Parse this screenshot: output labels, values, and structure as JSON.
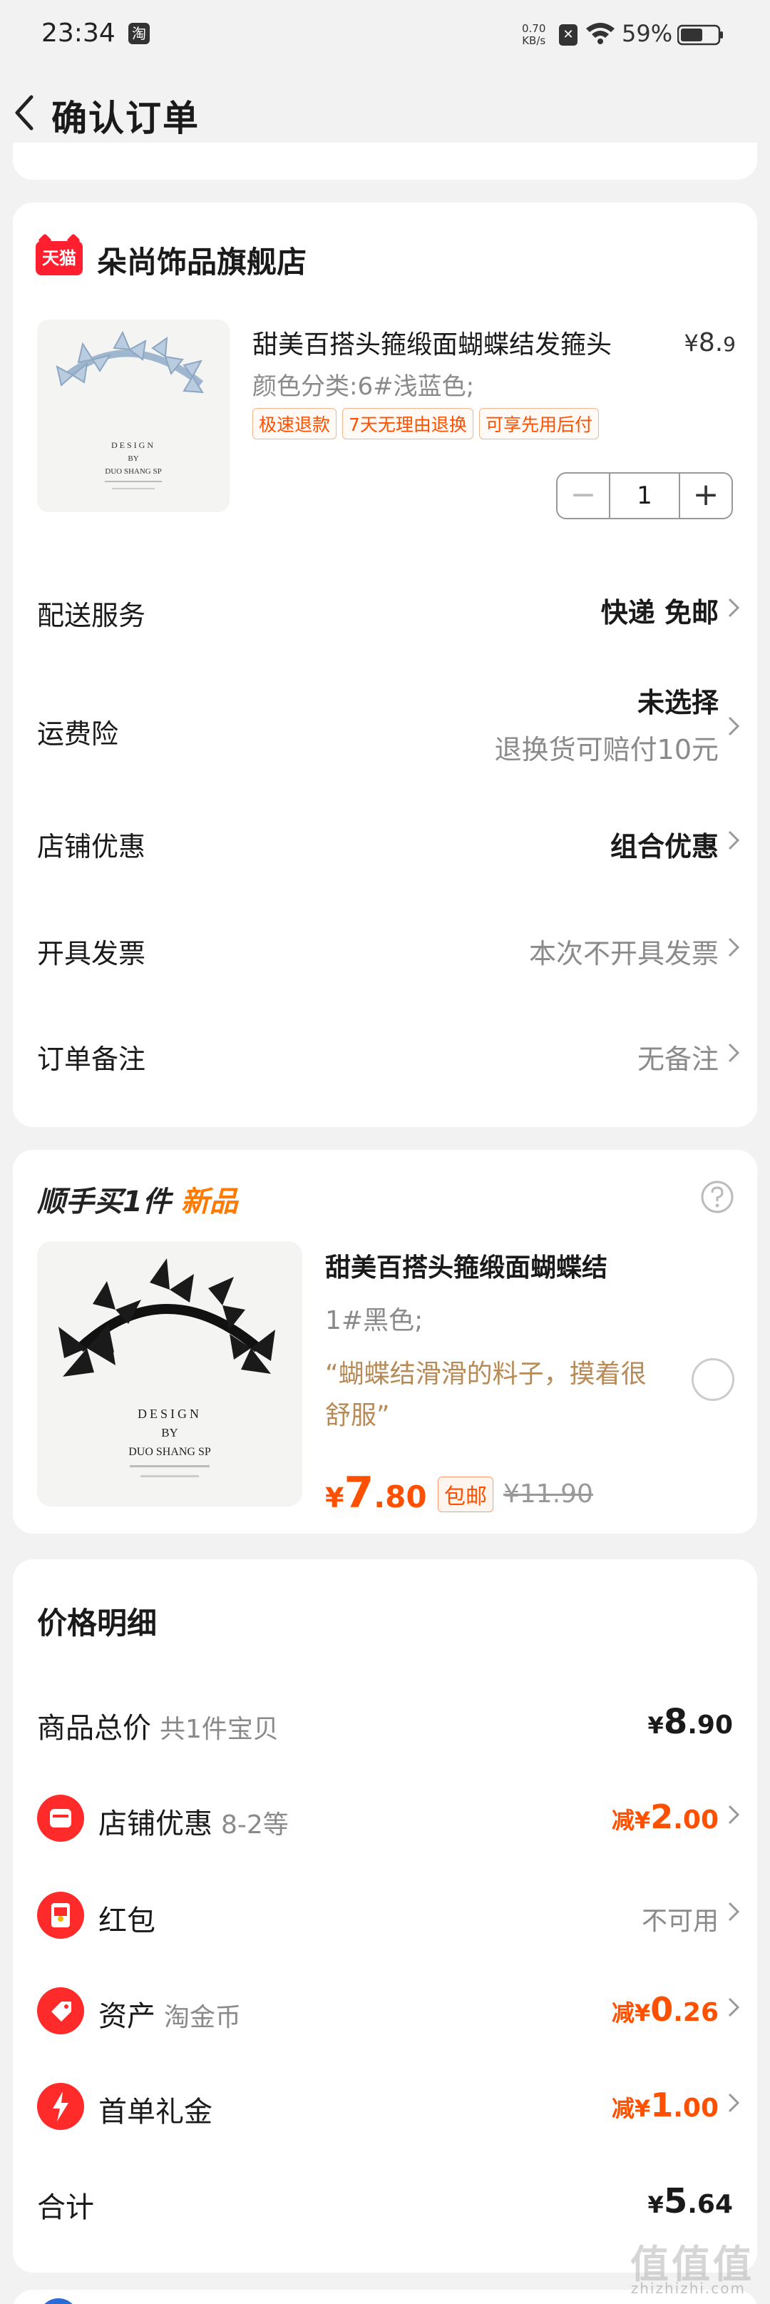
{
  "status": {
    "time": "23:34",
    "app_badge": "淘",
    "speed_value": "0.70",
    "speed_unit": "KB/s",
    "battery": "59%"
  },
  "nav": {
    "title": "确认订单"
  },
  "store": {
    "logo_text": "天猫",
    "name": "朵尚饰品旗舰店",
    "product": {
      "title": "甜美百搭头箍缎面蝴蝶结发箍头",
      "price_symbol": "¥",
      "price_int": "8.",
      "price_dec": "9",
      "sku": "颜色分类:6#浅蓝色;",
      "tags": [
        "极速退款",
        "7天无理由退换",
        "可享先用后付"
      ],
      "quantity": "1",
      "image_text": [
        "DESIGN",
        "BY",
        "DUO SHANG SP"
      ]
    },
    "rows": {
      "delivery": {
        "label": "配送服务",
        "value": "快递 免邮"
      },
      "freight": {
        "label": "运费险",
        "value": "未选择",
        "sub": "退换货可赔付10元"
      },
      "shop_discount": {
        "label": "店铺优惠",
        "value": "组合优惠"
      },
      "invoice": {
        "label": "开具发票",
        "value": "本次不开具发票"
      },
      "remark": {
        "label": "订单备注",
        "value": "无备注"
      }
    }
  },
  "addon": {
    "title": "顺手买1件",
    "title_new": "新品",
    "name": "甜美百搭头箍缎面蝴蝶结",
    "sku": "1#黑色;",
    "quote": "“蝴蝶结滑滑的料子，摸着很舒服”",
    "price_symbol": "¥",
    "price_int": "7",
    "price_dec": ".80",
    "free_shipping": "包邮",
    "original_price": "¥11.90",
    "image_text": [
      "DESIGN",
      "BY",
      "DUO SHANG SP"
    ]
  },
  "detail": {
    "title": "价格明细",
    "items": {
      "total_goods": {
        "label": "商品总价",
        "sub": "共1件宝贝",
        "pre": "¥",
        "int": "8",
        "dec": ".90"
      },
      "shop_discount": {
        "label": "店铺优惠",
        "sub": "8-2等",
        "pre": "减¥",
        "int": "2",
        "dec": ".00"
      },
      "red_packet": {
        "label": "红包",
        "value": "不可用"
      },
      "assets": {
        "label": "资产",
        "sub": "淘金币",
        "pre": "减¥",
        "int": "0",
        "dec": ".26"
      },
      "first_order": {
        "label": "首单礼金",
        "pre": "减¥",
        "int": "1",
        "dec": ".00"
      },
      "sum": {
        "label": "合计",
        "pre": "¥",
        "int": "5",
        "dec": ".64"
      }
    }
  },
  "watermark": {
    "main": "值值值",
    "sub": "zhizhizhi.com"
  },
  "colors": {
    "accent": "#ff5000",
    "tmall_red": "#ff1f2e",
    "gold_text": "#b88a55"
  }
}
